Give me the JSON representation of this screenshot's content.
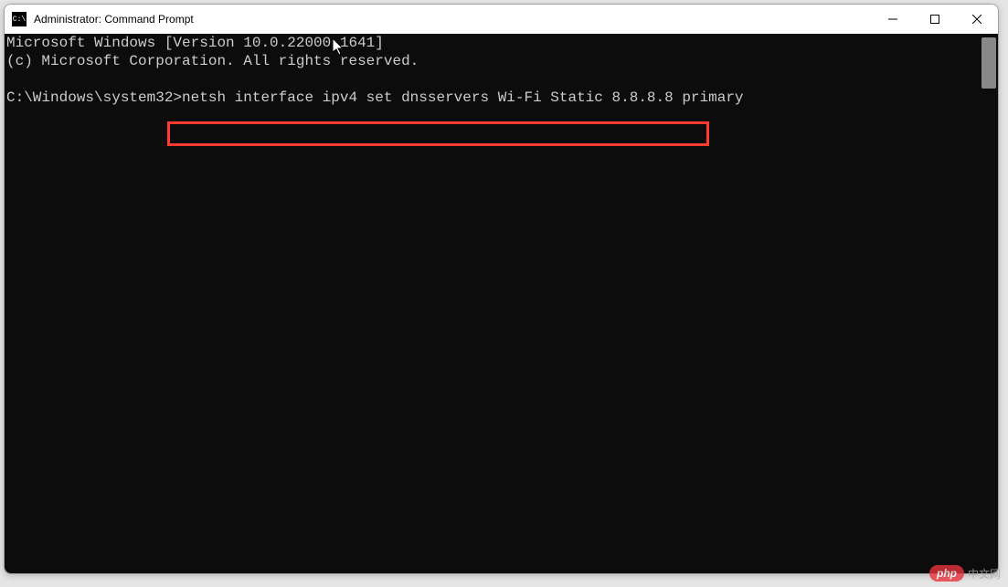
{
  "window": {
    "title": "Administrator: Command Prompt"
  },
  "console": {
    "line1": "Microsoft Windows [Version 10.0.22000.1641]",
    "line2": "(c) Microsoft Corporation. All rights reserved.",
    "blank1": "",
    "prompt": "C:\\Windows\\system32>",
    "command": "netsh interface ipv4 set dnsservers Wi-Fi Static 8.8.8.8 primary"
  },
  "watermark": {
    "badge": "php",
    "text": "中文网"
  }
}
